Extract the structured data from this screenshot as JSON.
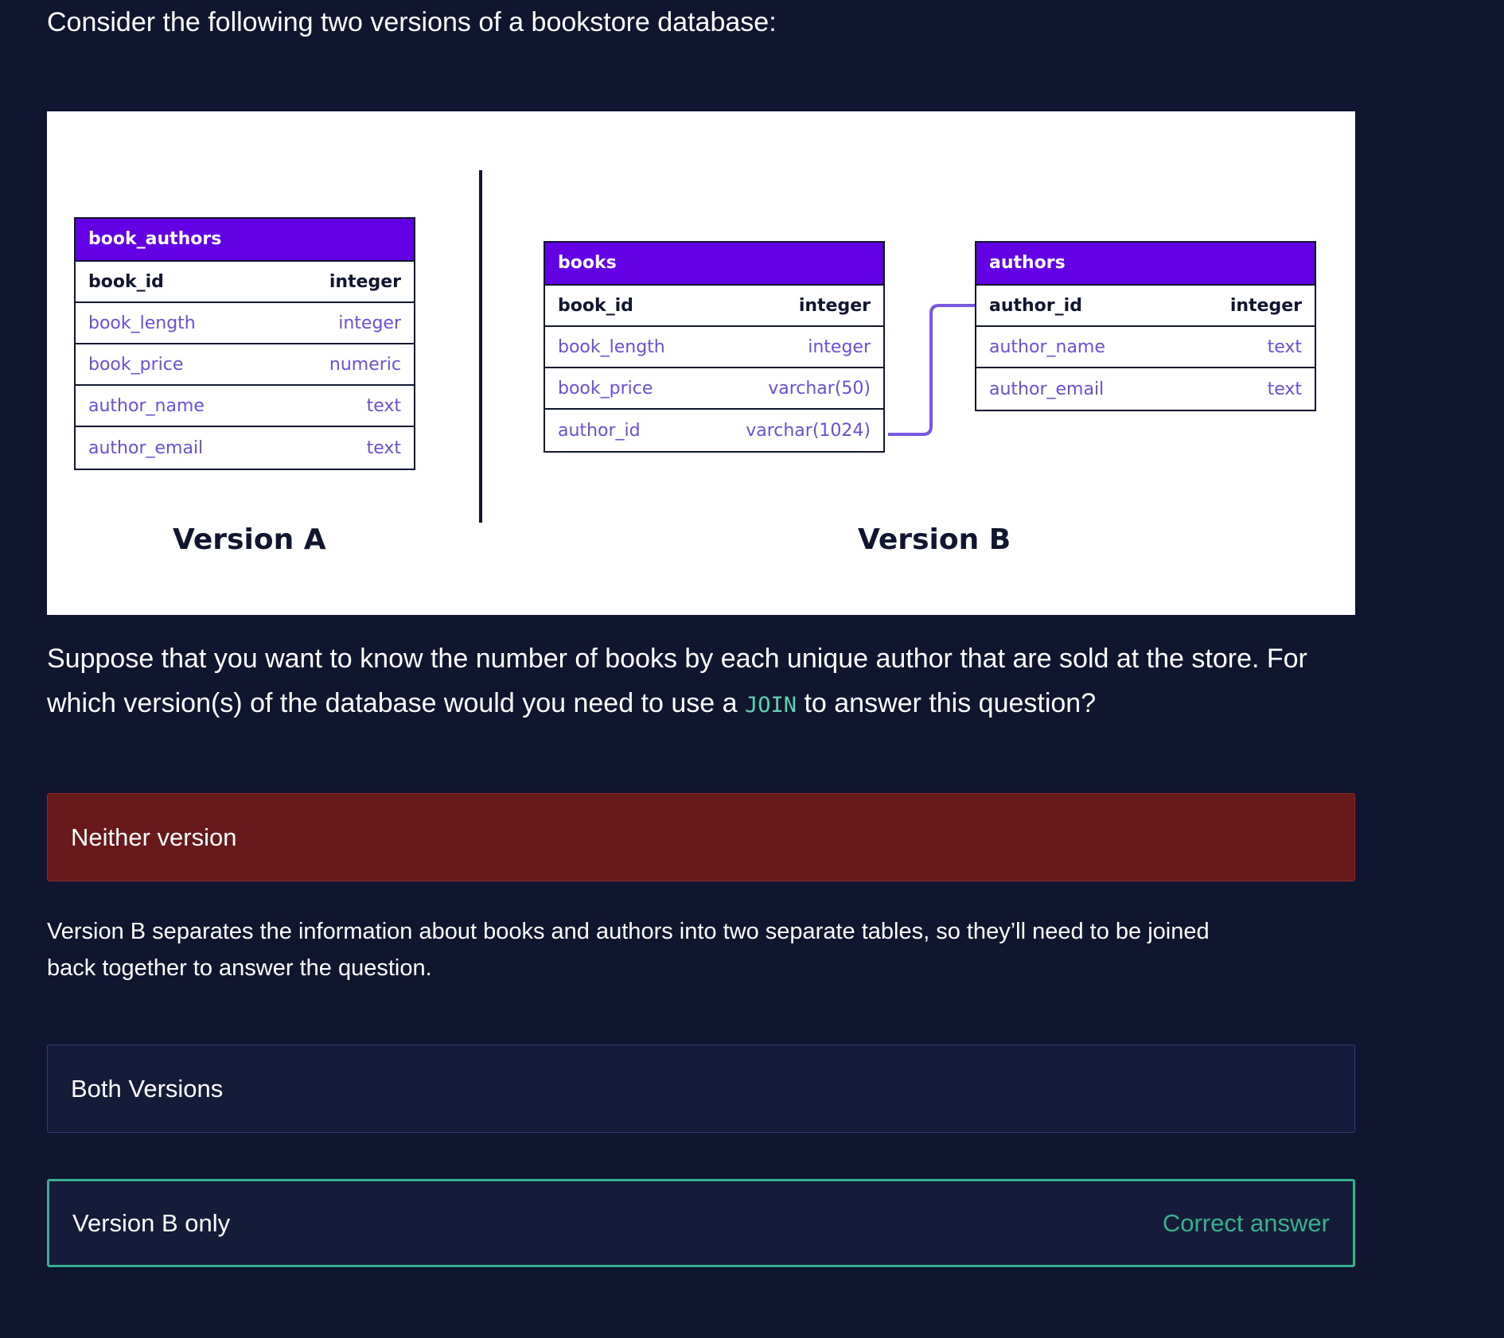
{
  "intro": "Consider the following two versions of a bookstore database:",
  "diagram": {
    "version_a": {
      "caption": "Version A",
      "table": {
        "name": "book_authors",
        "rows": [
          {
            "field": "book_id",
            "type": "integer"
          },
          {
            "field": "book_length",
            "type": "integer"
          },
          {
            "field": "book_price",
            "type": "numeric"
          },
          {
            "field": "author_name",
            "type": "text"
          },
          {
            "field": "author_email",
            "type": "text"
          }
        ]
      }
    },
    "version_b": {
      "caption": "Version B",
      "books": {
        "name": "books",
        "rows": [
          {
            "field": "book_id",
            "type": "integer"
          },
          {
            "field": "book_length",
            "type": "integer"
          },
          {
            "field": "book_price",
            "type": "varchar(50)"
          },
          {
            "field": "author_id",
            "type": "varchar(1024)"
          }
        ]
      },
      "authors": {
        "name": "authors",
        "rows": [
          {
            "field": "author_id",
            "type": "integer"
          },
          {
            "field": "author_name",
            "type": "text"
          },
          {
            "field": "author_email",
            "type": "text"
          }
        ]
      }
    },
    "colors": {
      "header": "#6400e4",
      "field": "#6b4fd8",
      "connector": "#7a57e0",
      "ink": "#10162f"
    }
  },
  "question": {
    "before": "Suppose that you want to know the number of books by each unique author that are sold at the store. For which version(s) of the database would you need to use a ",
    "code": "JOIN",
    "after": " to answer this question?"
  },
  "options": [
    {
      "label": "Neither version",
      "state": "incorrect"
    },
    {
      "label": "Both Versions",
      "state": "neutral"
    },
    {
      "label": "Version B only",
      "state": "correct",
      "tag": "Correct answer"
    }
  ],
  "feedback": "Version B separates the information about books and authors into two separate tables, so they’ll need to be joined back together to answer the question.",
  "colors": {
    "background": "#10162f",
    "incorrect": "#691919",
    "correct": "#37b08f",
    "code": "#5fd3b0"
  }
}
